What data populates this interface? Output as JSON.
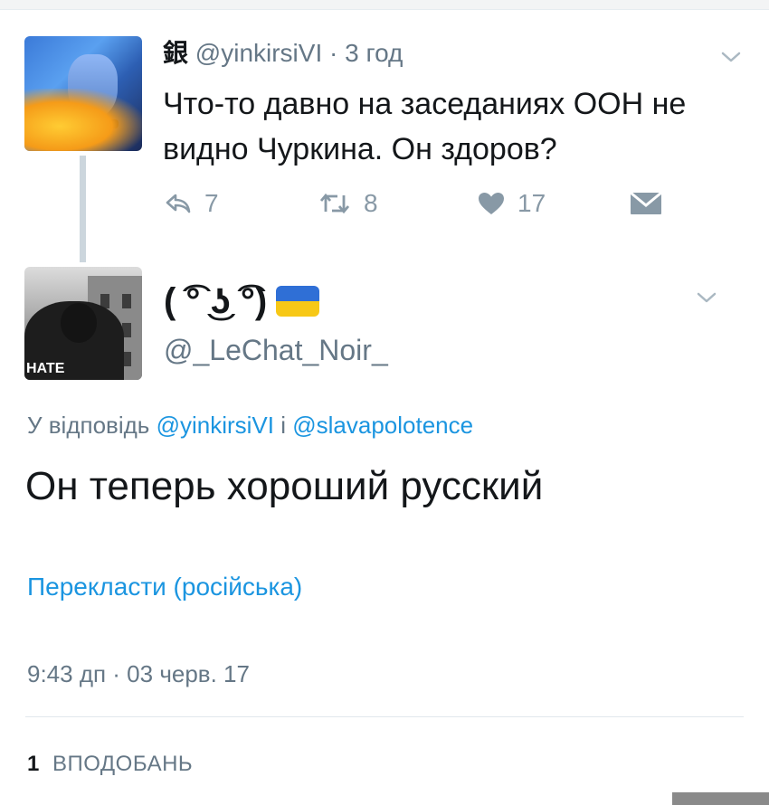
{
  "parent_tweet": {
    "display_name": "銀",
    "handle": "@yinkirsiVI",
    "separator": "·",
    "time": "3 год",
    "text_line_1": "Что-то давно на заседаниях ООН не",
    "text_line_2": "видно Чуркина. Он здоров?",
    "actions": {
      "reply_count": "7",
      "retweet_count": "8",
      "like_count": "17"
    }
  },
  "reply_tweet": {
    "display_name": "( ͡° ͜ʖ ͡°)",
    "handle": "@_LeChat_Noir_",
    "replying_to_prefix": "У відповідь",
    "replying_to_user_1": "@yinkirsiVI",
    "replying_to_conjunction": "і",
    "replying_to_user_2": "@slavapolotence",
    "text": "Он теперь хороший русский",
    "translate_label": "Перекласти (російська)",
    "timestamp": "9:43 дп · 03 черв. 17",
    "likes_count": "1",
    "likes_label": "ВПОДОБАНЬ"
  },
  "avatar_2_text": "HATE",
  "colors": {
    "link": "#1b95e0",
    "secondary_text": "#657786",
    "icon_gray": "#8899a6",
    "flag_blue": "#2f6fd6",
    "flag_yellow": "#f7c816"
  },
  "icons": {
    "menu": "chevron-down-icon",
    "reply": "reply-icon",
    "retweet": "retweet-icon",
    "like": "heart-icon",
    "dm": "envelope-icon",
    "flag": "ukraine-flag-icon"
  }
}
